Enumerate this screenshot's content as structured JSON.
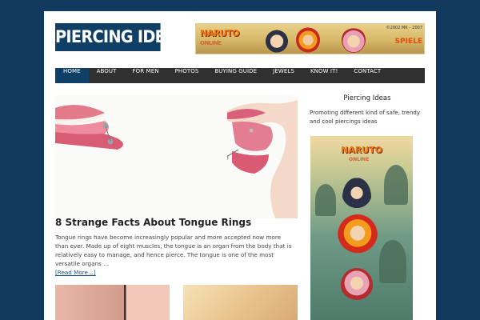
{
  "site": {
    "title": "PIERCING IDEAS"
  },
  "banner": {
    "logo_text": "NARUTO",
    "logo_sub": "ONLINE",
    "copyright": "©2002 MK – 2007",
    "tag": "SPIELE"
  },
  "nav": {
    "items": [
      {
        "label": "HOME",
        "active": true
      },
      {
        "label": "ABOUT",
        "active": false
      },
      {
        "label": "FOR MEN",
        "active": false
      },
      {
        "label": "PHOTOS",
        "active": false
      },
      {
        "label": "BUYING GUIDE",
        "active": false
      },
      {
        "label": "JEWELS",
        "active": false
      },
      {
        "label": "KNOW IT!",
        "active": false
      },
      {
        "label": "CONTACT",
        "active": false
      }
    ]
  },
  "post": {
    "title": "8 Strange Facts About Tongue Rings",
    "excerpt": "Tongue rings have become increasingly popular and more accepted now more than ever. Made up of eight muscles, the tongue is an organ from the body that is relatively easy to manage, and hence pierce. The tongue is one of the most versatile organs …",
    "read_more": "[Read More...]"
  },
  "sidebar": {
    "widget_title": "Piercing Ideas",
    "widget_text": "Promoting different kind of safe, trendy and cool piercings ideas",
    "ad_logo": "NARUTO",
    "ad_logo_sub": "ONLINE"
  },
  "colors": {
    "background": "#123a5e",
    "accent": "#0f3f65",
    "nav": "#303030"
  }
}
